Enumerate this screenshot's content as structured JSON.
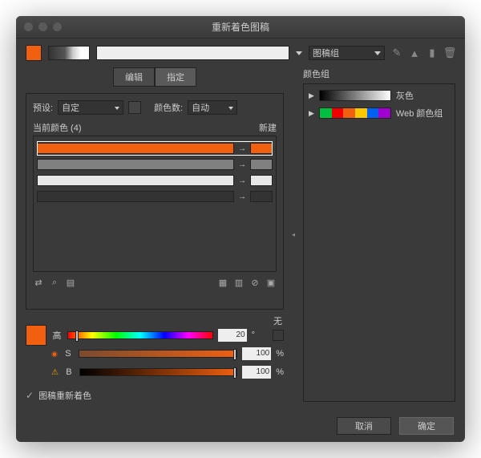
{
  "title": "重新着色图稿",
  "top": {
    "swatch_color": "#f06010",
    "dropdown_label": "图稿组"
  },
  "tabs": {
    "edit": "编辑",
    "assign": "指定"
  },
  "preset": {
    "label": "预设:",
    "value": "自定"
  },
  "colorcount": {
    "label": "颜色数:",
    "value": "自动"
  },
  "current": {
    "label": "当前颜色 (4)",
    "new_label": "新建"
  },
  "rows": [
    {
      "color": "#f06010",
      "new": "#f06010",
      "selected": true
    },
    {
      "color": "#808080",
      "new": "#808080",
      "selected": false
    },
    {
      "color": "#e8e8e8",
      "new": "#e8e8e8",
      "selected": false
    },
    {
      "color": "#333333",
      "new": "#333333",
      "selected": false
    }
  ],
  "none_label": "无",
  "sliders": {
    "swatch": "#f06010",
    "h": {
      "letter": "高",
      "grad": "linear-gradient(90deg,#f00,#ff0,#0f0,#0ff,#00f,#f0f,#f00)",
      "val": "20",
      "unit": "°",
      "pos": "5%"
    },
    "s": {
      "letter": "S",
      "grad": "linear-gradient(90deg,#7a4a30,#f06010)",
      "val": "100",
      "unit": "%",
      "pos": "100%"
    },
    "b": {
      "letter": "B",
      "grad": "linear-gradient(90deg,#000,#f06010)",
      "val": "100",
      "unit": "%",
      "pos": "100%"
    }
  },
  "checkbox": {
    "label": "图稿重新着色"
  },
  "rightpanel": {
    "label": "颜色组",
    "groups": [
      {
        "name": "灰色",
        "type": "gray"
      },
      {
        "name": "Web 颜色组",
        "type": "web"
      }
    ]
  },
  "web_colors": [
    "#00c040",
    "#f00000",
    "#f06010",
    "#f8c800",
    "#0060f0",
    "#a000d0"
  ],
  "buttons": {
    "cancel": "取消",
    "ok": "确定"
  }
}
